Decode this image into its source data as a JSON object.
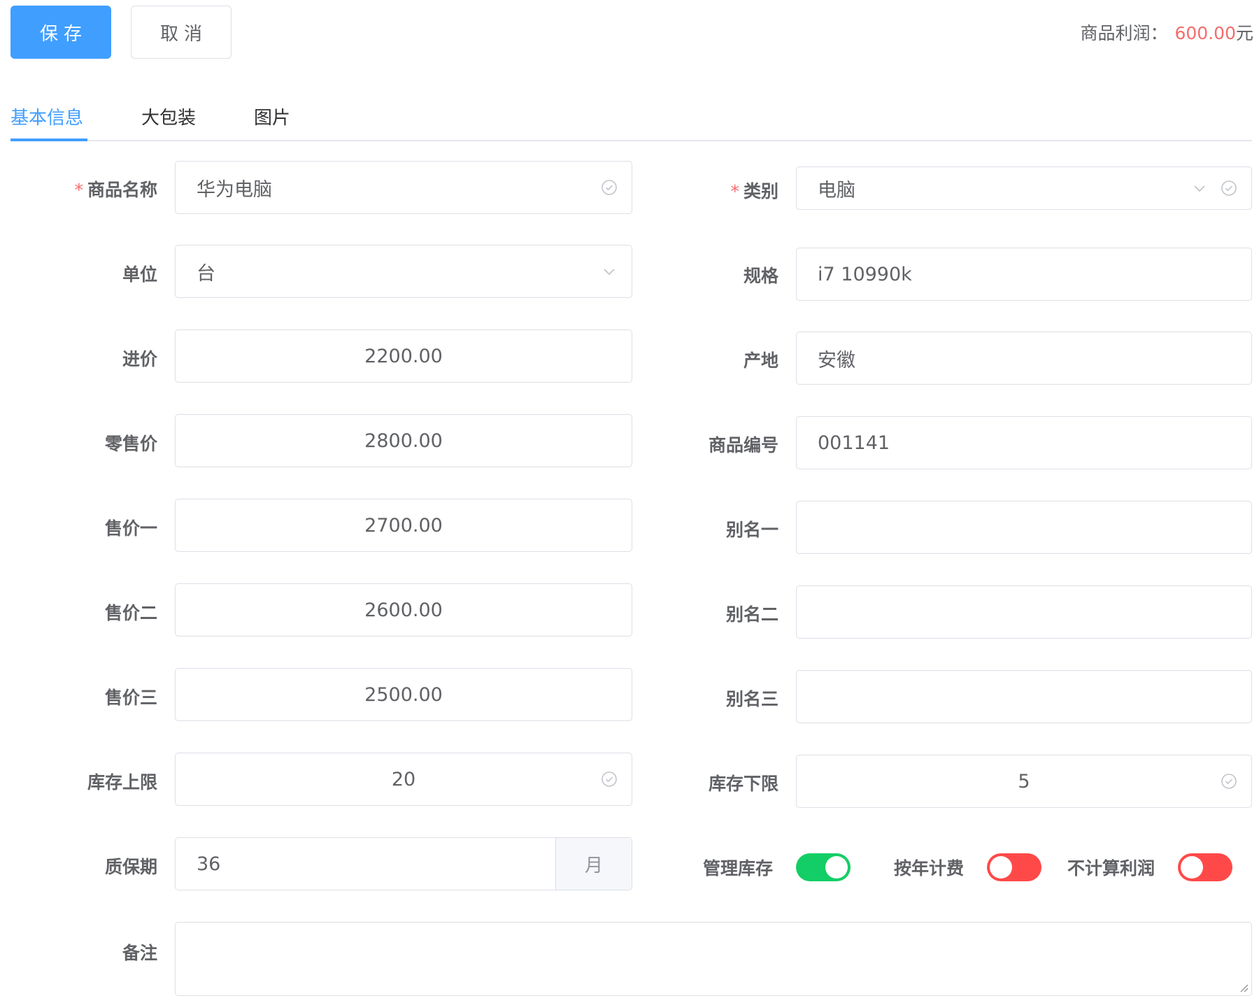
{
  "toolbar": {
    "save_label": "保存",
    "cancel_label": "取消"
  },
  "profit": {
    "label": "商品利润：",
    "value": "600.00",
    "unit": "元",
    "value_color": "#f56c6c"
  },
  "tabs": [
    {
      "label": "基本信息",
      "active": true
    },
    {
      "label": "大包装",
      "active": false
    },
    {
      "label": "图片",
      "active": false
    }
  ],
  "form": {
    "name": {
      "label": "商品名称",
      "required": true,
      "value": "华为电脑"
    },
    "category": {
      "label": "类别",
      "required": true,
      "value": "电脑"
    },
    "unit": {
      "label": "单位",
      "value": "台"
    },
    "spec": {
      "label": "规格",
      "value": "i7 10990k"
    },
    "purchase_price": {
      "label": "进价",
      "value": "2200.00"
    },
    "origin": {
      "label": "产地",
      "value": "安徽"
    },
    "retail_price": {
      "label": "零售价",
      "value": "2800.00"
    },
    "product_code": {
      "label": "商品编号",
      "value": "001141"
    },
    "price1": {
      "label": "售价一",
      "value": "2700.00"
    },
    "alias1": {
      "label": "别名一",
      "value": ""
    },
    "price2": {
      "label": "售价二",
      "value": "2600.00"
    },
    "alias2": {
      "label": "别名二",
      "value": ""
    },
    "price3": {
      "label": "售价三",
      "value": "2500.00"
    },
    "alias3": {
      "label": "别名三",
      "value": ""
    },
    "stock_max": {
      "label": "库存上限",
      "value": "20"
    },
    "stock_min": {
      "label": "库存下限",
      "value": "5"
    },
    "warranty": {
      "label": "质保期",
      "value": "36",
      "unit": "月"
    },
    "manage_stock": {
      "label": "管理库存",
      "on": true
    },
    "yearly_fee": {
      "label": "按年计费",
      "on": false
    },
    "no_profit": {
      "label": "不计算利润",
      "on": false
    },
    "remark": {
      "label": "备注",
      "value": ""
    }
  },
  "colors": {
    "primary": "#409eff",
    "switch_on": "#13ce66",
    "switch_off": "#ff4949",
    "danger": "#f56c6c"
  },
  "icons": {
    "valid": "check-circle-icon",
    "select": "chevron-down-icon",
    "resize": "resize-handle-icon"
  }
}
